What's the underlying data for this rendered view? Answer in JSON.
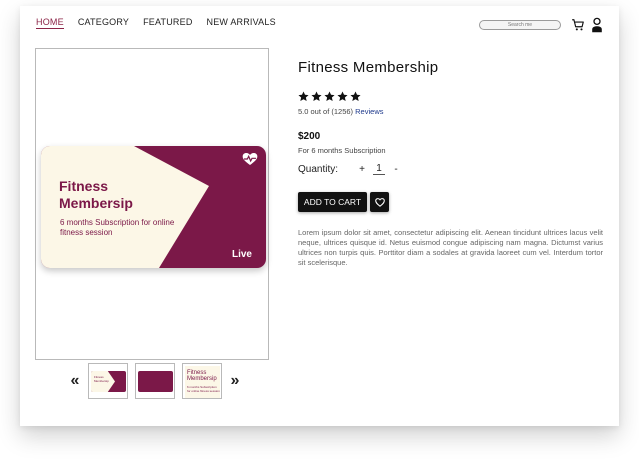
{
  "nav": {
    "items": [
      {
        "label": "HOME",
        "active": true
      },
      {
        "label": "CATEGORY",
        "active": false
      },
      {
        "label": "FEATURED",
        "active": false
      },
      {
        "label": "NEW ARRIVALS",
        "active": false
      }
    ]
  },
  "header": {
    "search_placeholder": "Search me",
    "cart_icon": "cart-icon",
    "user_icon": "user-icon"
  },
  "product_image": {
    "card_title": "Fitness Membersip",
    "card_subtitle": "6 months Subscription for online fitness session",
    "card_badge": "Live",
    "card_icon": "heart-pulse-icon",
    "colors": {
      "primary": "#7b1848",
      "cream": "#fcf7e7"
    }
  },
  "thumbnails": {
    "prev_label": "«",
    "next_label": "»",
    "third_title": "Fitness Membersip",
    "third_sub": "6 months Subscription for online fitness session"
  },
  "product": {
    "title": "Fitness Membership",
    "stars": 5,
    "rating_text": "5.0 out of (1256)",
    "reviews_label": "Reviews",
    "price": "$200",
    "price_note": "For 6 months Subscription",
    "quantity_label": "Quantity:",
    "quantity_plus": "+",
    "quantity_value": "1",
    "quantity_minus": "-",
    "add_to_cart_label": "ADD TO CART",
    "wishlist_icon": "heart-outline-icon",
    "description": "Lorem ipsum dolor sit amet, consectetur adipiscing elit. Aenean tincidunt ultrices lacus velit neque, ultrices quisque id. Netus euismod congue adipiscing nam magna. Dictumst varius ultrices non turpis quis. Porttitor diam a sodales at gravida laoreet cum vel. Interdum tortor sit scelerisque."
  }
}
